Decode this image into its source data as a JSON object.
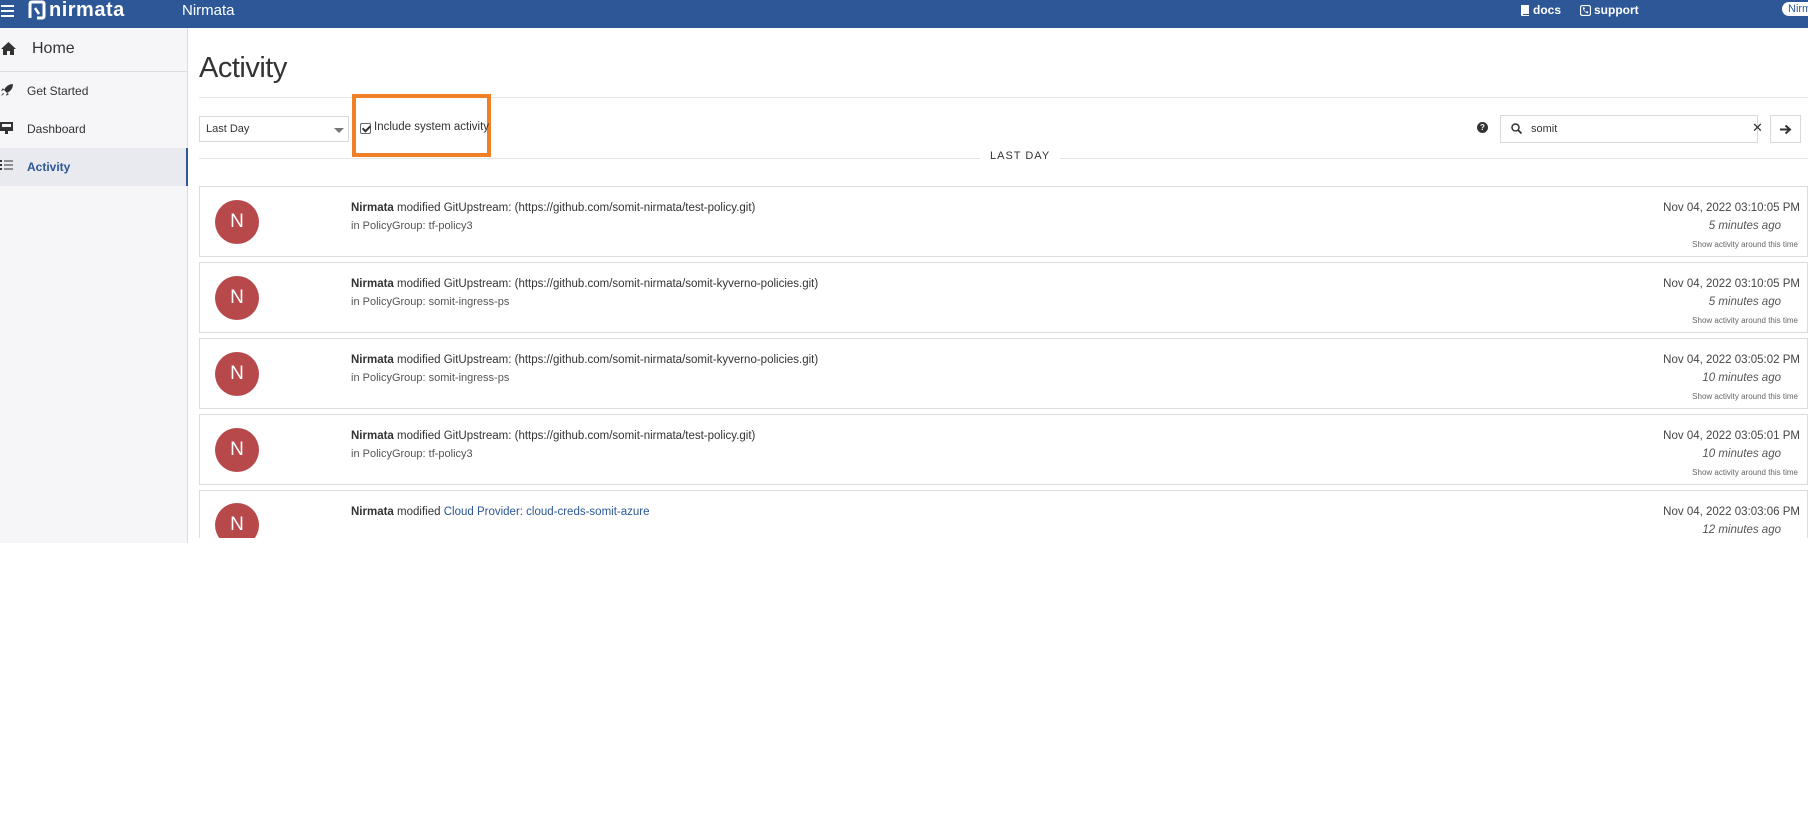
{
  "header": {
    "logo_text": "nirmata",
    "app_title": "Nirmata",
    "docs_label": "docs",
    "support_label": "support",
    "user_label": "Nirm"
  },
  "sidebar": {
    "home_label": "Home",
    "items": [
      {
        "label": "Get Started",
        "icon": "rocket-icon"
      },
      {
        "label": "Dashboard",
        "icon": "dashboard-icon"
      },
      {
        "label": "Activity",
        "icon": "list-icon",
        "active": true
      }
    ]
  },
  "main": {
    "title": "Activity",
    "range_select": {
      "value": "Last Day"
    },
    "system_activity": {
      "label": "Include system activity",
      "checked": true
    },
    "search": {
      "value": "somit"
    },
    "section_label": "LAST DAY",
    "activities": [
      {
        "avatar": "N",
        "user": "Nirmata",
        "action": "modified",
        "object": "GitUpstream: (https://github.com/somit-nirmata/test-policy.git)",
        "context": "in PolicyGroup: tf-policy3",
        "time": "Nov 04, 2022 03:10:05 PM",
        "ago": "5 minutes ago",
        "around": "Show activity around this time"
      },
      {
        "avatar": "N",
        "user": "Nirmata",
        "action": "modified",
        "object": "GitUpstream: (https://github.com/somit-nirmata/somit-kyverno-policies.git)",
        "context": "in PolicyGroup: somit-ingress-ps",
        "time": "Nov 04, 2022 03:10:05 PM",
        "ago": "5 minutes ago",
        "around": "Show activity around this time"
      },
      {
        "avatar": "N",
        "user": "Nirmata",
        "action": "modified",
        "object": "GitUpstream: (https://github.com/somit-nirmata/somit-kyverno-policies.git)",
        "context": "in PolicyGroup: somit-ingress-ps",
        "time": "Nov 04, 2022 03:05:02 PM",
        "ago": "10 minutes ago",
        "around": "Show activity around this time"
      },
      {
        "avatar": "N",
        "user": "Nirmata",
        "action": "modified",
        "object": "GitUpstream: (https://github.com/somit-nirmata/test-policy.git)",
        "context": "in PolicyGroup: tf-policy3",
        "time": "Nov 04, 2022 03:05:01 PM",
        "ago": "10 minutes ago",
        "around": "Show activity around this time"
      },
      {
        "avatar": "N",
        "user": "Nirmata",
        "action": "modified",
        "object": "Cloud Provider: cloud-creds-somit-azure",
        "object_is_link": true,
        "context": "",
        "time": "Nov 04, 2022 03:03:06 PM",
        "ago": "12 minutes ago",
        "around": ""
      }
    ]
  },
  "colors": {
    "header_bg": "#2d5797",
    "avatar_bg": "#b8494b",
    "highlight_box": "#f08026",
    "link": "#2d5797"
  }
}
